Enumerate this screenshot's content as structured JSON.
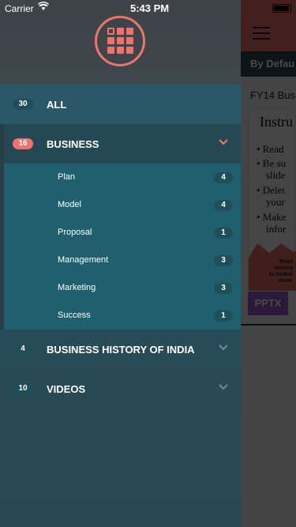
{
  "status_bar": {
    "carrier": "Carrier",
    "time": "5:43 PM"
  },
  "colors": {
    "accent": "#f0736b",
    "submenu_bg": "#20606e",
    "badge_dark": "#1e4f5b"
  },
  "drawer": {
    "items": [
      {
        "label": "ALL",
        "count": "30"
      },
      {
        "label": "BUSINESS",
        "count": "16",
        "expanded": true,
        "children": [
          {
            "label": "Plan",
            "count": "4"
          },
          {
            "label": "Model",
            "count": "4"
          },
          {
            "label": "Proposal",
            "count": "1"
          },
          {
            "label": "Management",
            "count": "3"
          },
          {
            "label": "Marketing",
            "count": "3"
          },
          {
            "label": "Success",
            "count": "1"
          }
        ]
      },
      {
        "label": "BUSINESS HISTORY OF INDIA",
        "count": "4"
      },
      {
        "label": "VIDEOS",
        "count": "10"
      }
    ]
  },
  "main": {
    "filter_label": "By Defau",
    "card_title": "FY14 Bus",
    "thumb_title": "Instru",
    "thumb_lines": [
      "• Read",
      "• Be su",
      "slide",
      "• Delet",
      "your",
      "• Make",
      "infor"
    ],
    "thumb_note": [
      "Read",
      "section",
      "to includ",
      "rema"
    ],
    "file_type": "PPTX"
  }
}
